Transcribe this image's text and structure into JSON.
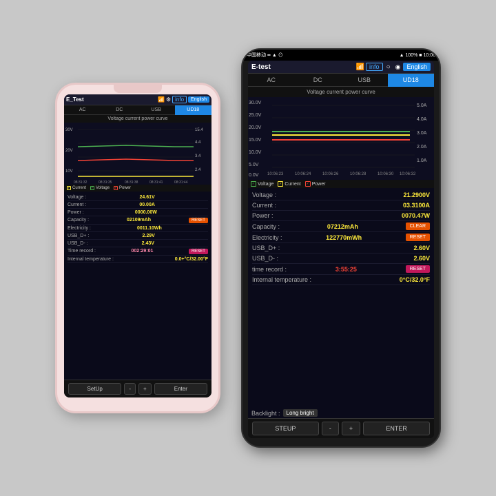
{
  "scene": {
    "bg": "#c8c8c8"
  },
  "phone1": {
    "header": {
      "title": "E_Test",
      "info": "info",
      "lang": "English"
    },
    "tabs": [
      "AC",
      "DC",
      "USB",
      "UD18"
    ],
    "chart_title": "Voltage current power curve",
    "y_labels": [
      "30V",
      "20V",
      "10V"
    ],
    "y_right": [
      "15.4",
      "4.4",
      "3.4",
      "2.4"
    ],
    "x_labels": [
      "08:31:32",
      "08:31:35",
      "08:31:38",
      "08:31:41",
      "08:31:44"
    ],
    "legend": [
      "Current",
      "Voltage",
      "Power"
    ],
    "data": [
      {
        "label": "Voltage :",
        "value": "24.61V",
        "color": "yellow"
      },
      {
        "label": "Current :",
        "value": "00.00A",
        "color": "yellow"
      },
      {
        "label": "Power :",
        "value": "0000.00W",
        "color": "yellow"
      },
      {
        "label": "Capacity :",
        "value": "02109mAh",
        "color": "yellow"
      },
      {
        "label": "Electricity :",
        "value": "0011.10Wh",
        "color": "yellow"
      },
      {
        "label": "USB_D+ :",
        "value": "2.29V",
        "color": "yellow"
      },
      {
        "label": "USB_D- :",
        "value": "2.43V",
        "color": "yellow"
      },
      {
        "label": "Time record :",
        "value": "002:29:01",
        "color": "pink"
      },
      {
        "label": "Internal temperature :",
        "value": "0.0+°C/32.00°F",
        "color": "yellow"
      }
    ],
    "buttons": [
      "SetUp",
      "-",
      "+",
      "Enter"
    ]
  },
  "phone2": {
    "status": "中国移动 ☰ ▪▪ ▲  ⊙ ▲ 100%▪ 10:06",
    "header": {
      "title": "E-test",
      "info": "info",
      "lang": "English"
    },
    "tabs": [
      "AC",
      "DC",
      "USB",
      "UD18"
    ],
    "chart_title": "Voltage current power curve",
    "y_labels": [
      "30.0V",
      "25.0V",
      "20.0V",
      "15.0V",
      "10.0V",
      "5.0V",
      "0.0V"
    ],
    "y_right": [
      "5.0A",
      "4.0A",
      "3.0A",
      "2.0A",
      "1.0A"
    ],
    "x_labels": [
      "10:06:23",
      "10:06:24",
      "10:06:26",
      "10:06:28",
      "10:06:30",
      "10:06:32"
    ],
    "legend": [
      "Voltage",
      "Current",
      "Power"
    ],
    "data": [
      {
        "label": "Voltage :",
        "value": "21.2900V",
        "color": "yellow"
      },
      {
        "label": "Current :",
        "value": "03.3100A",
        "color": "yellow"
      },
      {
        "label": "Power :",
        "value": "0070.47W",
        "color": "yellow"
      },
      {
        "label": "Capacity :",
        "value": "07212mAh",
        "color": "yellow"
      },
      {
        "label": "Electricity :",
        "value": "122770mWh",
        "color": "yellow"
      },
      {
        "label": "USB_D+ :",
        "value": "2.60V",
        "color": "yellow"
      },
      {
        "label": "USB_D- :",
        "value": "2.60V",
        "color": "yellow"
      },
      {
        "label": "time record :",
        "value": "3:55:25",
        "color": "red"
      },
      {
        "label": "Internal temperature :",
        "value": "0°C/32.0°F",
        "color": "yellow"
      }
    ],
    "backlight_label": "Backlight :",
    "backlight_value": "Long bright",
    "buttons": [
      "STEUP",
      "-",
      "+",
      "ENTER"
    ],
    "btn_reset": "RESET",
    "btn_clear": "CLEAR"
  }
}
